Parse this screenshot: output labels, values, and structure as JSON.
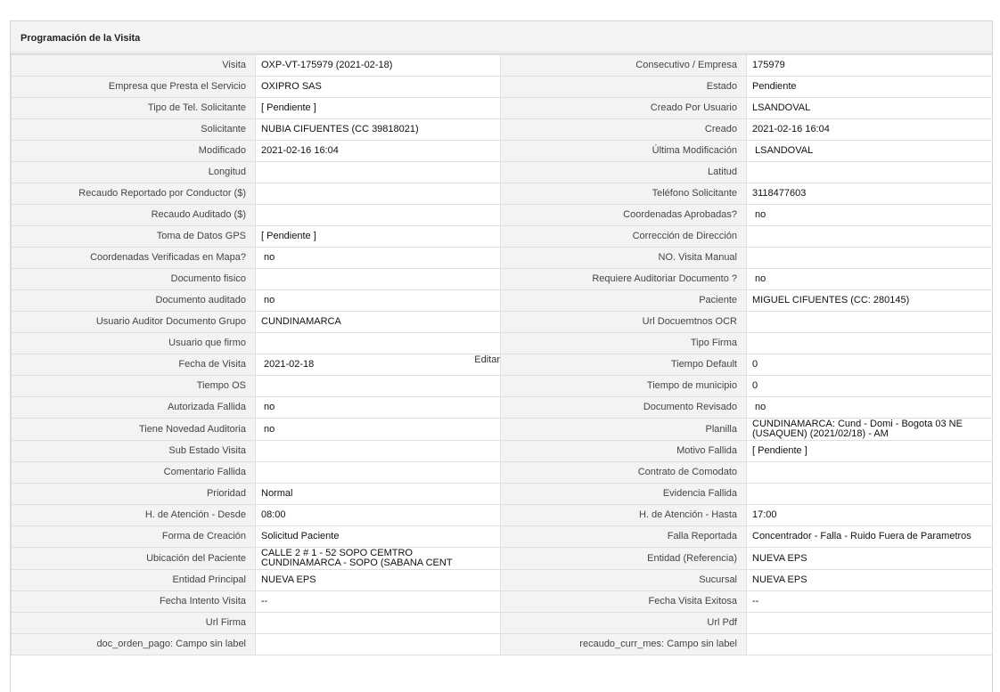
{
  "panel": {
    "title": "Programación de la Visita",
    "edit_label": "Editar"
  },
  "rows": [
    {
      "left": {
        "label": "Visita",
        "value": "OXP-VT-175979 (2021-02-18)"
      },
      "right": {
        "label": "Consecutivo / Empresa",
        "value": "175979"
      }
    },
    {
      "left": {
        "label": "Empresa que Presta el Servicio",
        "value": "OXIPRO SAS"
      },
      "right": {
        "label": "Estado",
        "value": "Pendiente"
      }
    },
    {
      "left": {
        "label": "Tipo de Tel. Solicitante",
        "value": "[ Pendiente ]"
      },
      "right": {
        "label": "Creado Por Usuario",
        "value": "LSANDOVAL"
      }
    },
    {
      "left": {
        "label": "Solicitante",
        "value": "NUBIA CIFUENTES (CC 39818021)"
      },
      "right": {
        "label": "Creado",
        "value": "2021-02-16 16:04"
      }
    },
    {
      "left": {
        "label": "Modificado",
        "value": "2021-02-16 16:04"
      },
      "right": {
        "label": "Última Modificación",
        "value": "LSANDOVAL"
      }
    },
    {
      "left": {
        "label": "Longitud",
        "value": ""
      },
      "right": {
        "label": "Latitud",
        "value": ""
      }
    },
    {
      "left": {
        "label": "Recaudo Reportado por Conductor ($)",
        "value": ""
      },
      "right": {
        "label": "Teléfono Solicitante",
        "value": "3118477603"
      }
    },
    {
      "left": {
        "label": "Recaudo Auditado ($)",
        "value": ""
      },
      "right": {
        "label": "Coordenadas Aprobadas?",
        "value": "no"
      }
    },
    {
      "left": {
        "label": "Toma de Datos GPS",
        "value": "[ Pendiente ]"
      },
      "right": {
        "label": "Corrección de Dirección",
        "value": ""
      }
    },
    {
      "left": {
        "label": "Coordenadas Verificadas en Mapa?",
        "value": "no"
      },
      "right": {
        "label": "NO. Visita Manual",
        "value": ""
      }
    },
    {
      "left": {
        "label": "Documento fisico",
        "value": ""
      },
      "right": {
        "label": "Requiere Auditoriar Documento ?",
        "value": "no"
      }
    },
    {
      "left": {
        "label": "Documento auditado",
        "value": "no"
      },
      "right": {
        "label": "Paciente",
        "value": "MIGUEL CIFUENTES (CC: 280145)"
      }
    },
    {
      "left": {
        "label": "Usuario Auditor Documento Grupo",
        "value": "CUNDINAMARCA"
      },
      "right": {
        "label": "Url Docuemtnos OCR",
        "value": ""
      }
    },
    {
      "left": {
        "label": "Usuario que firmo",
        "value": ""
      },
      "right": {
        "label": "Tipo Firma",
        "value": ""
      }
    },
    {
      "left": {
        "label": "Fecha de Visita",
        "value": "2021-02-18"
      },
      "right": {
        "label": "Tiempo Default",
        "value": "0"
      }
    },
    {
      "left": {
        "label": "Tiempo OS",
        "value": ""
      },
      "right": {
        "label": "Tiempo de municipio",
        "value": "0"
      }
    },
    {
      "left": {
        "label": "Autorizada Fallida",
        "value": "no"
      },
      "right": {
        "label": "Documento Revisado",
        "value": "no"
      }
    },
    {
      "left": {
        "label": "Tiene Novedad Auditoria",
        "value": "no"
      },
      "right": {
        "label": "Planilla",
        "value": "CUNDINAMARCA: Cund - Domi - Bogota 03 NE (USAQUEN) (2021/02/18) - AM"
      }
    },
    {
      "left": {
        "label": "Sub Estado Visita",
        "value": ""
      },
      "right": {
        "label": "Motivo Fallida",
        "value": "[ Pendiente ]"
      }
    },
    {
      "left": {
        "label": "Comentario Fallida",
        "value": ""
      },
      "right": {
        "label": "Contrato de Comodato",
        "value": ""
      }
    },
    {
      "left": {
        "label": "Prioridad",
        "value": "Normal"
      },
      "right": {
        "label": "Evidencia Fallida",
        "value": ""
      }
    },
    {
      "left": {
        "label": "H. de Atención - Desde",
        "value": "08:00"
      },
      "right": {
        "label": "H. de Atención - Hasta",
        "value": "17:00"
      }
    },
    {
      "left": {
        "label": "Forma de Creación",
        "value": "Solicitud Paciente"
      },
      "right": {
        "label": "Falla Reportada",
        "value": "Concentrador - Falla - Ruido Fuera de Parametros"
      }
    },
    {
      "left": {
        "label": "Ubicación del Paciente",
        "value": "CALLE 2 # 1 - 52 SOPO CEMTRO CUNDINAMARCA - SOPO (SABANA CENT"
      },
      "right": {
        "label": "Entidad (Referencia)",
        "value": "NUEVA EPS"
      }
    },
    {
      "left": {
        "label": "Entidad Principal",
        "value": "NUEVA EPS"
      },
      "right": {
        "label": "Sucursal",
        "value": "NUEVA EPS"
      }
    },
    {
      "left": {
        "label": "Fecha Intento Visita",
        "value": "--"
      },
      "right": {
        "label": "Fecha Visita Exitosa",
        "value": "--"
      }
    },
    {
      "left": {
        "label": "Url Firma",
        "value": ""
      },
      "right": {
        "label": "Url Pdf",
        "value": ""
      }
    },
    {
      "left": {
        "label": "doc_orden_pago: Campo sin label",
        "value": ""
      },
      "right": {
        "label": "recaudo_curr_mes: Campo sin label",
        "value": ""
      }
    }
  ]
}
